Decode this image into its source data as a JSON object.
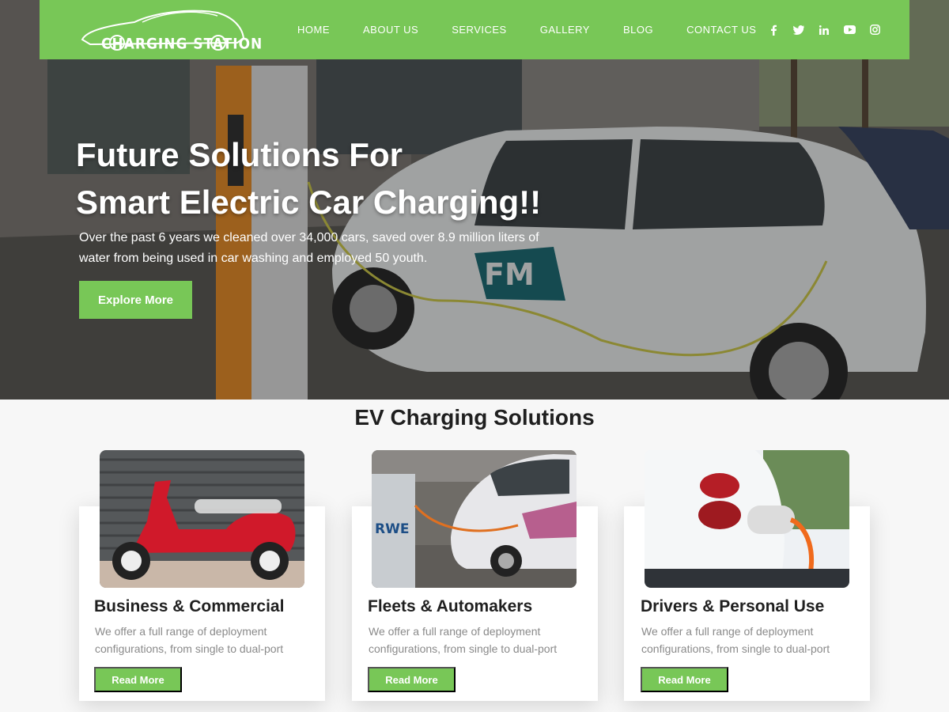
{
  "brand": {
    "logo_text": "CHARGING STATION"
  },
  "nav": {
    "items": [
      {
        "label": "HOME"
      },
      {
        "label": "ABOUT US"
      },
      {
        "label": "SERVICES"
      },
      {
        "label": "GALLERY"
      },
      {
        "label": "BLOG"
      },
      {
        "label": "CONTACT US"
      }
    ],
    "social": [
      {
        "icon": "facebook-icon",
        "glyph": "f"
      },
      {
        "icon": "twitter-icon",
        "glyph": "🐦"
      },
      {
        "icon": "linkedin-icon",
        "glyph": "in"
      },
      {
        "icon": "youtube-icon",
        "glyph": "▶"
      },
      {
        "icon": "instagram-icon",
        "glyph": "◎"
      }
    ]
  },
  "hero": {
    "title_line1": "Future Solutions For",
    "title_line2": "Smart Electric Car Charging!!",
    "text": "Over the past 6 years we cleaned over 34,000 cars, saved over 8.9 million liters of water from being used in car washing and employed 50 youth.",
    "button_label": "Explore More",
    "car_decal": "FM"
  },
  "section": {
    "title": "EV Charging Solutions",
    "cards": [
      {
        "title": "Business & Commercial",
        "text": "We offer a full range of deployment configurations, from single to dual-port",
        "button_label": "Read More"
      },
      {
        "title": "Fleets & Automakers",
        "text": "We offer a full range of deployment configurations, from single to dual-port",
        "button_label": "Read More"
      },
      {
        "title": "Drivers & Personal Use",
        "text": "We offer a full range of deployment configurations, from single to dual-port",
        "button_label": "Read More"
      }
    ]
  },
  "colors": {
    "accent": "#78c757",
    "heading": "#1f1f1f",
    "muted": "#8a8a8a"
  }
}
